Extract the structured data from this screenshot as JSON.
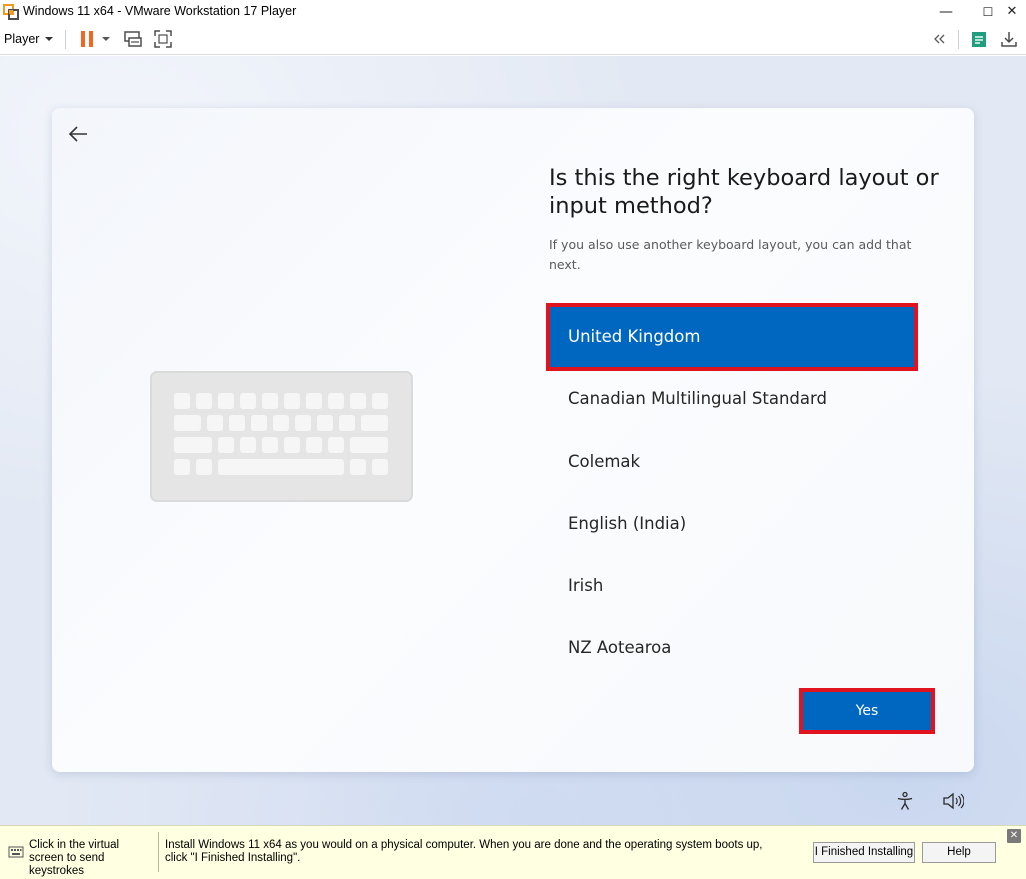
{
  "window": {
    "title": "Windows 11 x64 - VMware Workstation 17 Player",
    "minimize_glyph": "—",
    "maximize_glyph": "☐",
    "close_glyph": "✕"
  },
  "toolbar": {
    "player_menu_label": "Player",
    "icons": [
      "pause-icon",
      "send-ctrl-alt-del-icon",
      "full-screen-icon",
      "collapse-toolbar-icon",
      "notes-icon",
      "download-icon"
    ],
    "pause_color": "#f26522"
  },
  "oobe": {
    "heading": "Is this the right keyboard layout or input method?",
    "subtext": "If you also use another keyboard layout, you can add that next.",
    "layouts": [
      {
        "label": "United Kingdom",
        "selected": true
      },
      {
        "label": "Canadian Multilingual Standard",
        "selected": false
      },
      {
        "label": "Colemak",
        "selected": false
      },
      {
        "label": "English (India)",
        "selected": false
      },
      {
        "label": "Irish",
        "selected": false
      },
      {
        "label": "NZ Aotearoa",
        "selected": false
      }
    ],
    "yes_label": "Yes",
    "accent_color": "#0067c0",
    "highlight_color": "#e0131f",
    "icons": [
      "back-arrow-icon",
      "keyboard-illustration",
      "accessibility-icon",
      "volume-icon"
    ]
  },
  "hintbar": {
    "left_text": "Click in the virtual screen to send keystrokes",
    "main_text": "Install Windows 11 x64 as you would on a physical computer. When you are done and the operating system boots up, click \"I Finished Installing\".",
    "finished_button": "I Finished Installing",
    "help_button": "Help",
    "close_glyph": "✕",
    "background_color": "#ffffe1"
  }
}
